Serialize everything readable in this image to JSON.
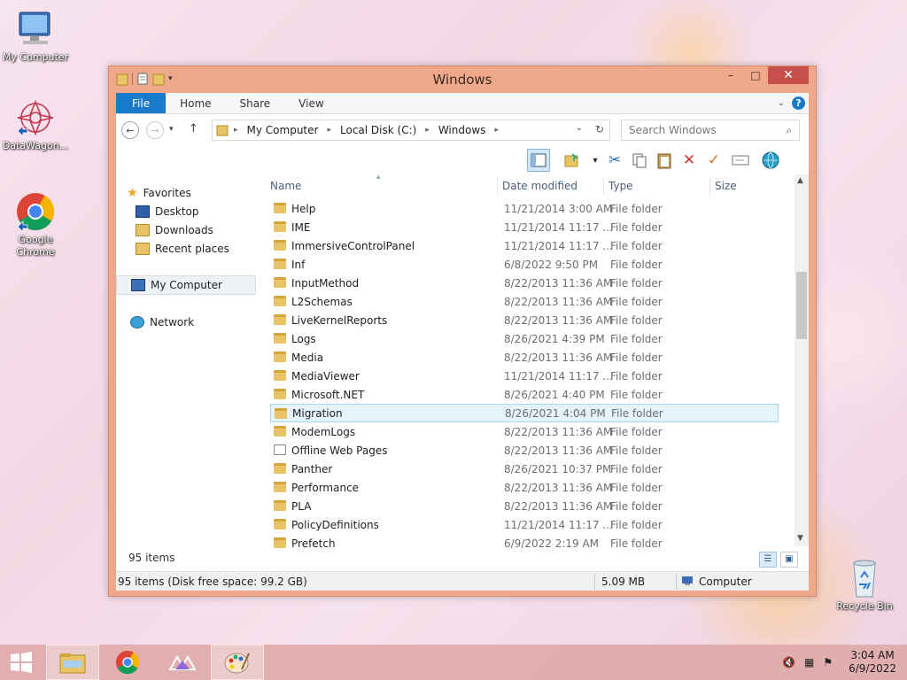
{
  "desktop": {
    "icons": [
      {
        "label": "My Computer",
        "icon": "computer-icon"
      },
      {
        "label": "DataWagon...",
        "icon": "datawagon-icon"
      },
      {
        "label": "Google Chrome",
        "icon": "chrome-icon"
      },
      {
        "label": "Recycle Bin",
        "icon": "recycle-bin-icon"
      }
    ]
  },
  "window": {
    "title": "Windows",
    "controls": {
      "minimize": "–",
      "maximize": "□",
      "close": "✕"
    },
    "ribbon_tabs": [
      "File",
      "Home",
      "Share",
      "View"
    ],
    "help": "?",
    "address": {
      "crumbs": [
        "My Computer",
        "Local Disk (C:)",
        "Windows"
      ]
    },
    "search": {
      "placeholder": "Search Windows"
    },
    "nav": {
      "favorites": "Favorites",
      "desktop": "Desktop",
      "downloads": "Downloads",
      "recent": "Recent places",
      "my_computer": "My Computer",
      "network": "Network"
    },
    "columns": {
      "name": "Name",
      "date": "Date modified",
      "type": "Type",
      "size": "Size"
    },
    "files": [
      {
        "name": "Help",
        "date": "11/21/2014 3:00 AM",
        "type": "File folder"
      },
      {
        "name": "IME",
        "date": "11/21/2014 11:17 ...",
        "type": "File folder"
      },
      {
        "name": "ImmersiveControlPanel",
        "date": "11/21/2014 11:17 ...",
        "type": "File folder"
      },
      {
        "name": "Inf",
        "date": "6/8/2022 9:50 PM",
        "type": "File folder"
      },
      {
        "name": "InputMethod",
        "date": "8/22/2013 11:36 AM",
        "type": "File folder"
      },
      {
        "name": "L2Schemas",
        "date": "8/22/2013 11:36 AM",
        "type": "File folder"
      },
      {
        "name": "LiveKernelReports",
        "date": "8/22/2013 11:36 AM",
        "type": "File folder"
      },
      {
        "name": "Logs",
        "date": "8/26/2021 4:39 PM",
        "type": "File folder"
      },
      {
        "name": "Media",
        "date": "8/22/2013 11:36 AM",
        "type": "File folder"
      },
      {
        "name": "MediaViewer",
        "date": "11/21/2014 11:17 ...",
        "type": "File folder"
      },
      {
        "name": "Microsoft.NET",
        "date": "8/26/2021 4:40 PM",
        "type": "File folder"
      },
      {
        "name": "Migration",
        "date": "8/26/2021 4:04 PM",
        "type": "File folder"
      },
      {
        "name": "ModemLogs",
        "date": "8/22/2013 11:36 AM",
        "type": "File folder"
      },
      {
        "name": "Offline Web Pages",
        "date": "8/22/2013 11:36 AM",
        "type": "File folder"
      },
      {
        "name": "Panther",
        "date": "8/26/2021 10:37 PM",
        "type": "File folder"
      },
      {
        "name": "Performance",
        "date": "8/22/2013 11:36 AM",
        "type": "File folder"
      },
      {
        "name": "PLA",
        "date": "8/22/2013 11:36 AM",
        "type": "File folder"
      },
      {
        "name": "PolicyDefinitions",
        "date": "11/21/2014 11:17 ...",
        "type": "File folder"
      },
      {
        "name": "Prefetch",
        "date": "6/9/2022 2:19 AM",
        "type": "File folder"
      }
    ],
    "selected_file": "Migration",
    "item_count": "95 items",
    "status": {
      "left": "95 items (Disk free space: 99.2 GB)",
      "size": "5.09 MB",
      "location": "Computer"
    }
  },
  "taskbar": {
    "items": [
      "start-icon",
      "file-explorer-icon",
      "chrome-icon",
      "datawagon-icon",
      "paint-icon"
    ],
    "clock_time": "3:04 AM",
    "clock_date": "6/9/2022"
  },
  "colors": {
    "window_frame": "#f0a88a",
    "accent_blue": "#1979ca",
    "close_red": "#c7504c",
    "selection": "#e5f3fb"
  }
}
